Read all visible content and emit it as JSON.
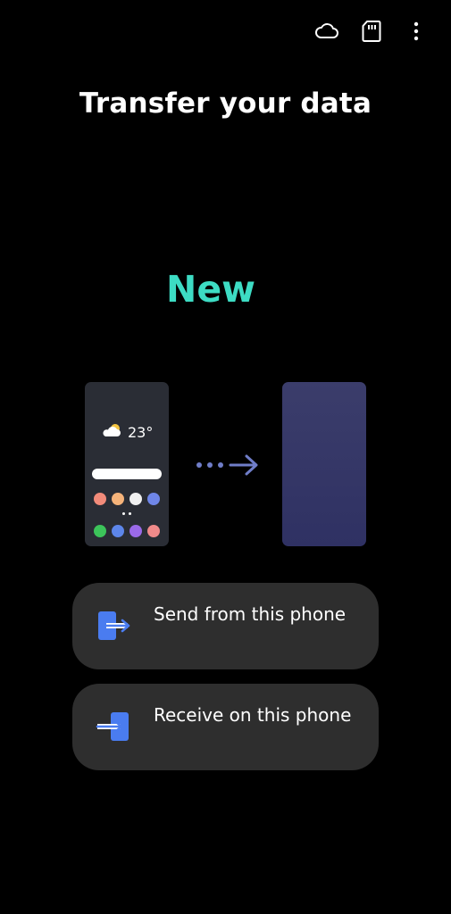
{
  "header": {
    "icons": [
      "cloud-icon",
      "sd-card-icon",
      "more-options-icon"
    ]
  },
  "page_title": "Transfer your data",
  "illustration": {
    "label": "New",
    "weather_temp": "23°",
    "colors": {
      "label": "#3ddcc4",
      "old_phone": "#2a2d35",
      "new_phone": "#33356a",
      "arrow": "#6f7dc8"
    }
  },
  "options": [
    {
      "label": "Send from this phone",
      "icon": "send-icon"
    },
    {
      "label": "Receive on this phone",
      "icon": "receive-icon"
    }
  ],
  "colors": {
    "background": "#000000",
    "card": "#2e2e2e",
    "accent_blue": "#4a7cf0"
  }
}
